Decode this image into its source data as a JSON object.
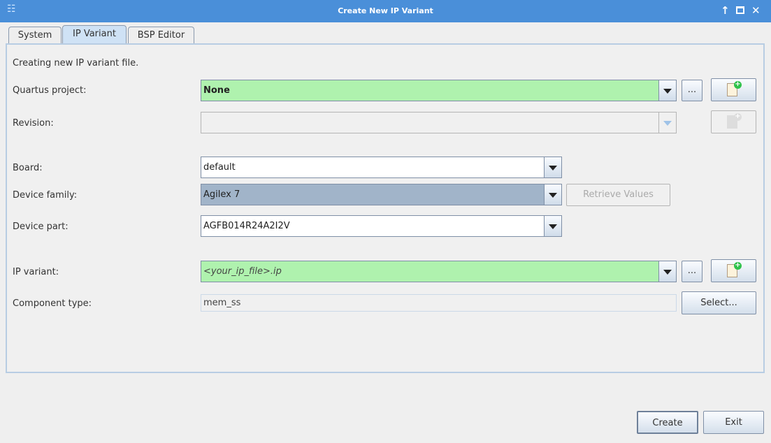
{
  "window": {
    "title": "Create New IP Variant"
  },
  "tabs": [
    {
      "label": "System"
    },
    {
      "label": "IP Variant"
    },
    {
      "label": "BSP Editor"
    }
  ],
  "intro": "Creating new IP variant file.",
  "fields": {
    "quartus_project": {
      "label": "Quartus project:",
      "value": "None"
    },
    "revision": {
      "label": "Revision:",
      "value": ""
    },
    "board": {
      "label": "Board:",
      "value": "default"
    },
    "device_family": {
      "label": "Device family:",
      "value": "Agilex 7"
    },
    "device_part": {
      "label": "Device part:",
      "value": "AGFB014R24A2I2V"
    },
    "ip_variant": {
      "label": "IP variant:",
      "value": "<your_ip_file>.ip"
    },
    "component_type": {
      "label": "Component type:",
      "value": "mem_ss"
    }
  },
  "buttons": {
    "browse": "...",
    "retrieve": "Retrieve Values",
    "select": "Select...",
    "create": "Create",
    "exit": "Exit"
  },
  "colors": {
    "titlebar": "#4a8fd9",
    "valid_green": "#aff2ae",
    "selected_combo": "#a1b4c9"
  }
}
